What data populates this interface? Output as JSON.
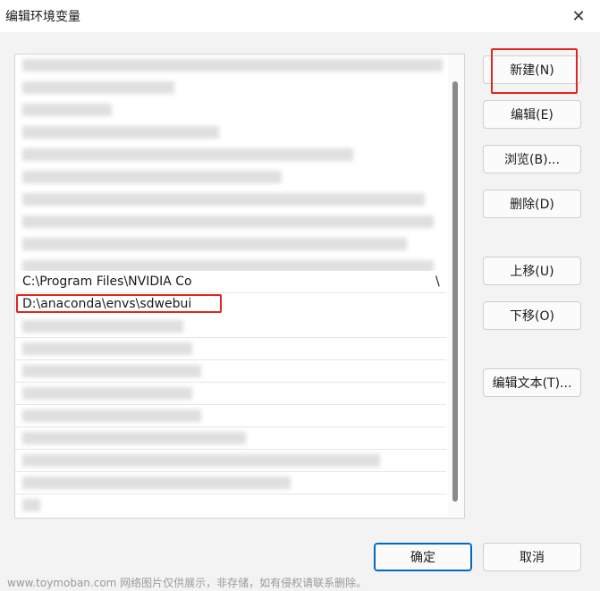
{
  "window": {
    "title": "编辑环境变量",
    "close_glyph": "✕"
  },
  "list": {
    "visible_items": [
      {
        "text": "C:\\Program Files\\NVIDIA Co",
        "trailing": "\\"
      },
      {
        "text": "D:\\anaconda\\envs\\sdwebui"
      }
    ]
  },
  "buttons": {
    "new": "新建(N)",
    "edit": "编辑(E)",
    "browse": "浏览(B)...",
    "delete": "删除(D)",
    "move_up": "上移(U)",
    "move_down": "下移(O)",
    "edit_text": "编辑文本(T)...",
    "ok": "确定",
    "cancel": "取消"
  },
  "watermark": "www.toymoban.com 网络图片仅供展示，非存储，如有侵权请联系删除。",
  "colors": {
    "highlight": "#e0261e",
    "primary_border": "#0067c0",
    "dialog_bg": "#f3f3f3"
  }
}
